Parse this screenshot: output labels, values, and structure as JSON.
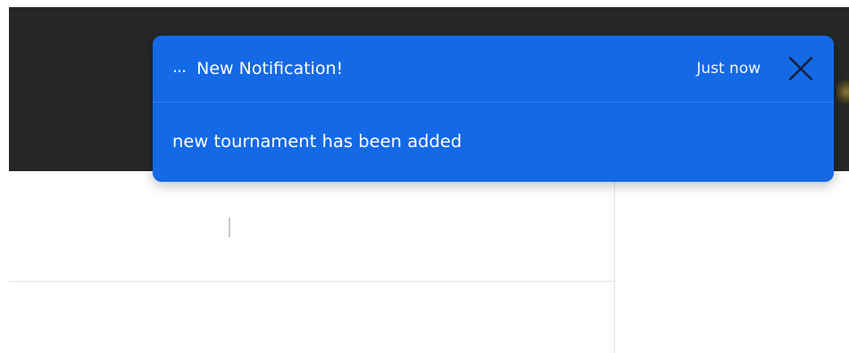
{
  "toast": {
    "dots": "...",
    "title": "New Notification!",
    "time": "Just now",
    "close_icon": "close-icon",
    "message": "new tournament has been added"
  },
  "colors": {
    "toast_background": "#1469e6",
    "top_bar": "#262626",
    "page_background": "#ffffff",
    "text": "#ffffff"
  }
}
